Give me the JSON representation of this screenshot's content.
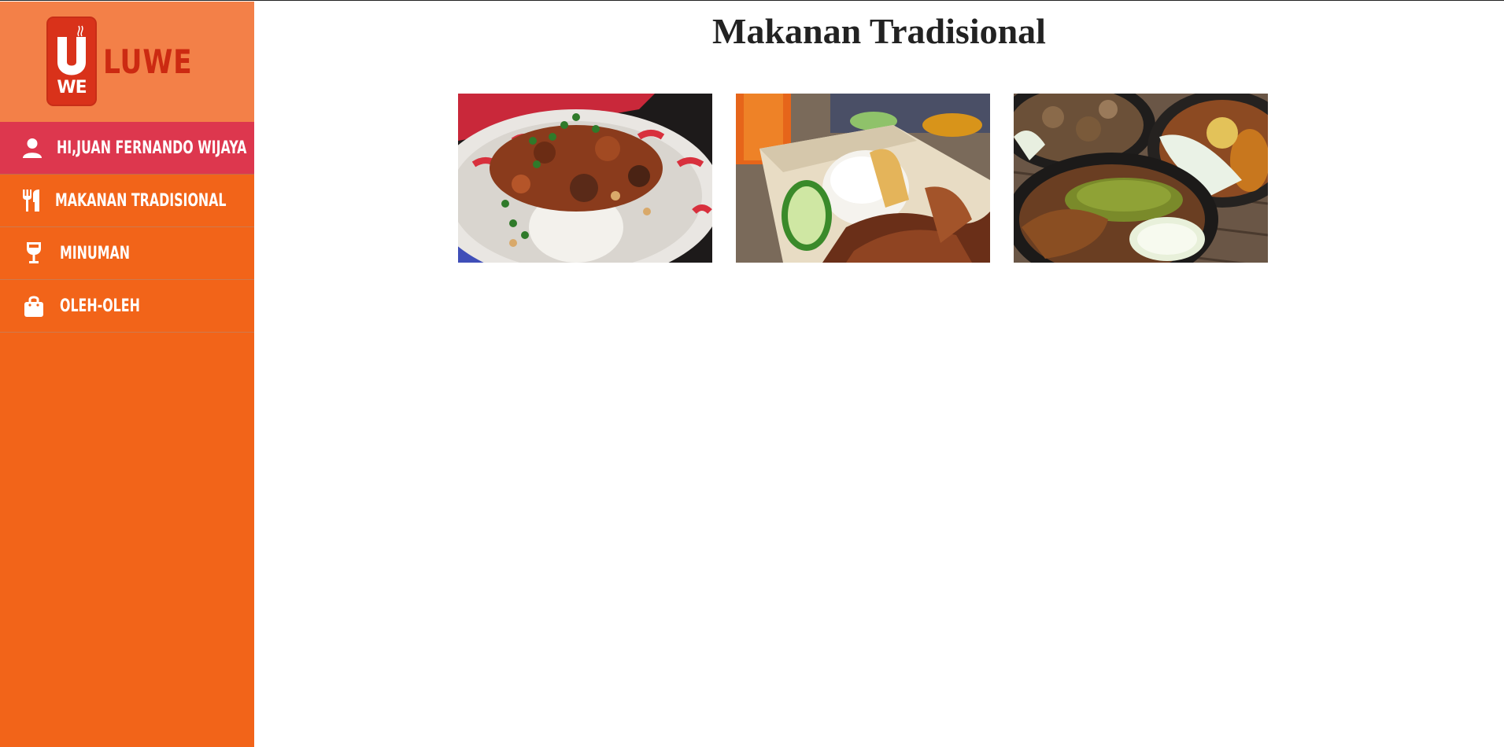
{
  "brand": {
    "name": "LUWE",
    "badge_text": "WE",
    "logo_icon": "luwe-logo-icon"
  },
  "sidebar": {
    "items": [
      {
        "label": "Hi,Juan Fernando Wijaya",
        "icon": "user-icon",
        "active": true
      },
      {
        "label": "Makanan Tradisional",
        "icon": "fork-knife-icon",
        "active": false
      },
      {
        "label": "Minuman",
        "icon": "wine-glass-icon",
        "active": false
      },
      {
        "label": "Oleh-Oleh",
        "icon": "shopping-bag-icon",
        "active": false
      }
    ]
  },
  "main": {
    "title": "Makanan Tradisional",
    "photos": [
      {
        "name": "food-photo-rice-bowl"
      },
      {
        "name": "food-photo-fried-duck-rice"
      },
      {
        "name": "food-photo-stone-plates"
      }
    ]
  },
  "colors": {
    "sidebar_bg": "#f26419",
    "brand_bg": "#f38048",
    "active_item_bg": "#dd374e",
    "brand_red": "#cc2a12"
  }
}
